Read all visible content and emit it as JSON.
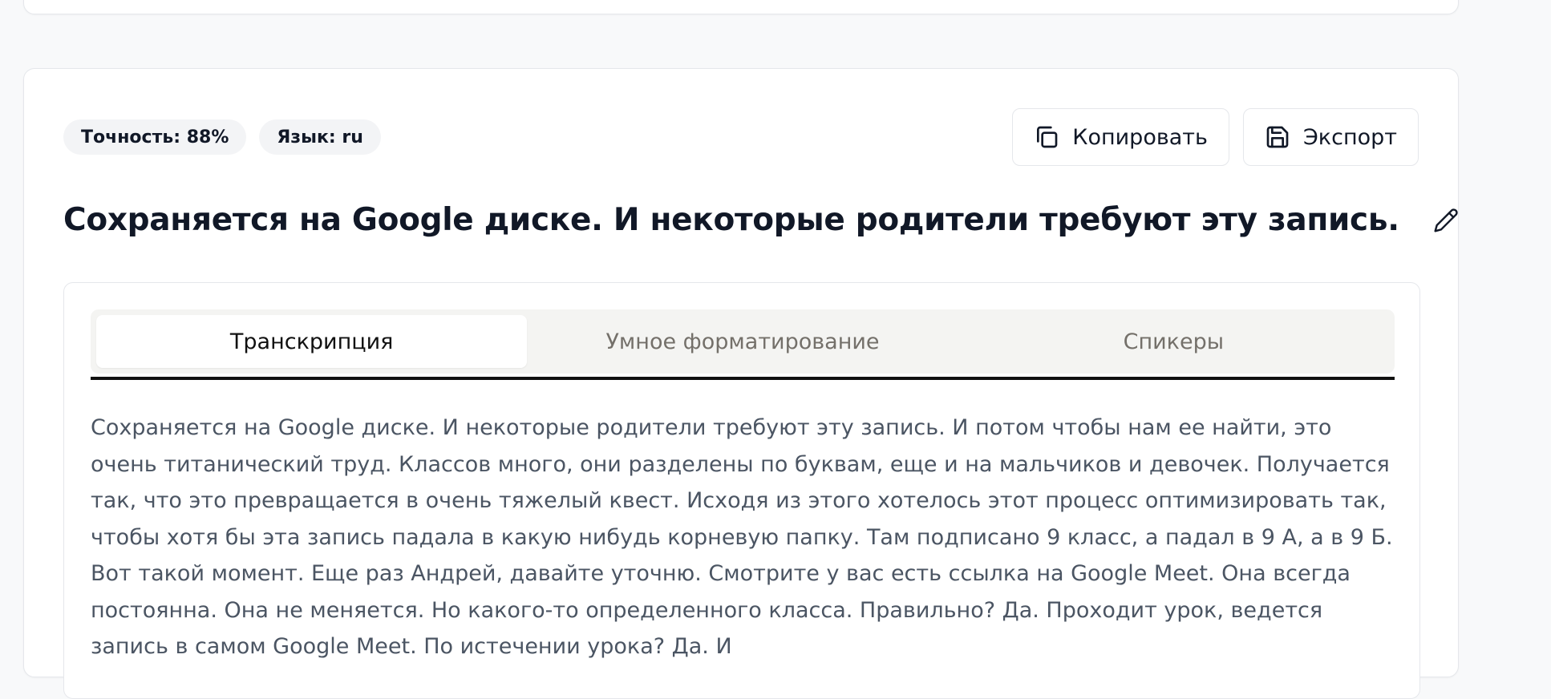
{
  "badges": {
    "accuracy": "Точность: 88%",
    "language": "Язык: ru"
  },
  "actions": {
    "copy_label": "Копировать",
    "export_label": "Экспорт"
  },
  "title": "Сохраняется на Google диске. И некоторые родители требуют эту запись.",
  "tabs": [
    {
      "label": "Транскрипция",
      "active": true
    },
    {
      "label": "Умное форматирование",
      "active": false
    },
    {
      "label": "Спикеры",
      "active": false
    }
  ],
  "transcript": "Сохраняется на Google диске. И некоторые родители требуют эту запись. И потом чтобы нам ее найти, это очень титанический труд. Классов много, они разделены по буквам, еще и на мальчиков и девочек. Получается так, что это превращается в очень тяжелый квест. Исходя из этого хотелось этот процесс оптимизировать так, чтобы хотя бы эта запись падала в какую нибудь корневую папку. Там подписано 9 класс, а падал в 9 А, а в 9 Б. Вот такой момент. Еще раз Андрей, давайте уточню. Смотрите у вас есть ссылка на Google Meet. Она всегда постоянна. Она не меняется. Но какого-то определенного класса. Правильно? Да. Проходит урок, ведется запись в самом Google Meet. По истечении урока? Да. И"
}
